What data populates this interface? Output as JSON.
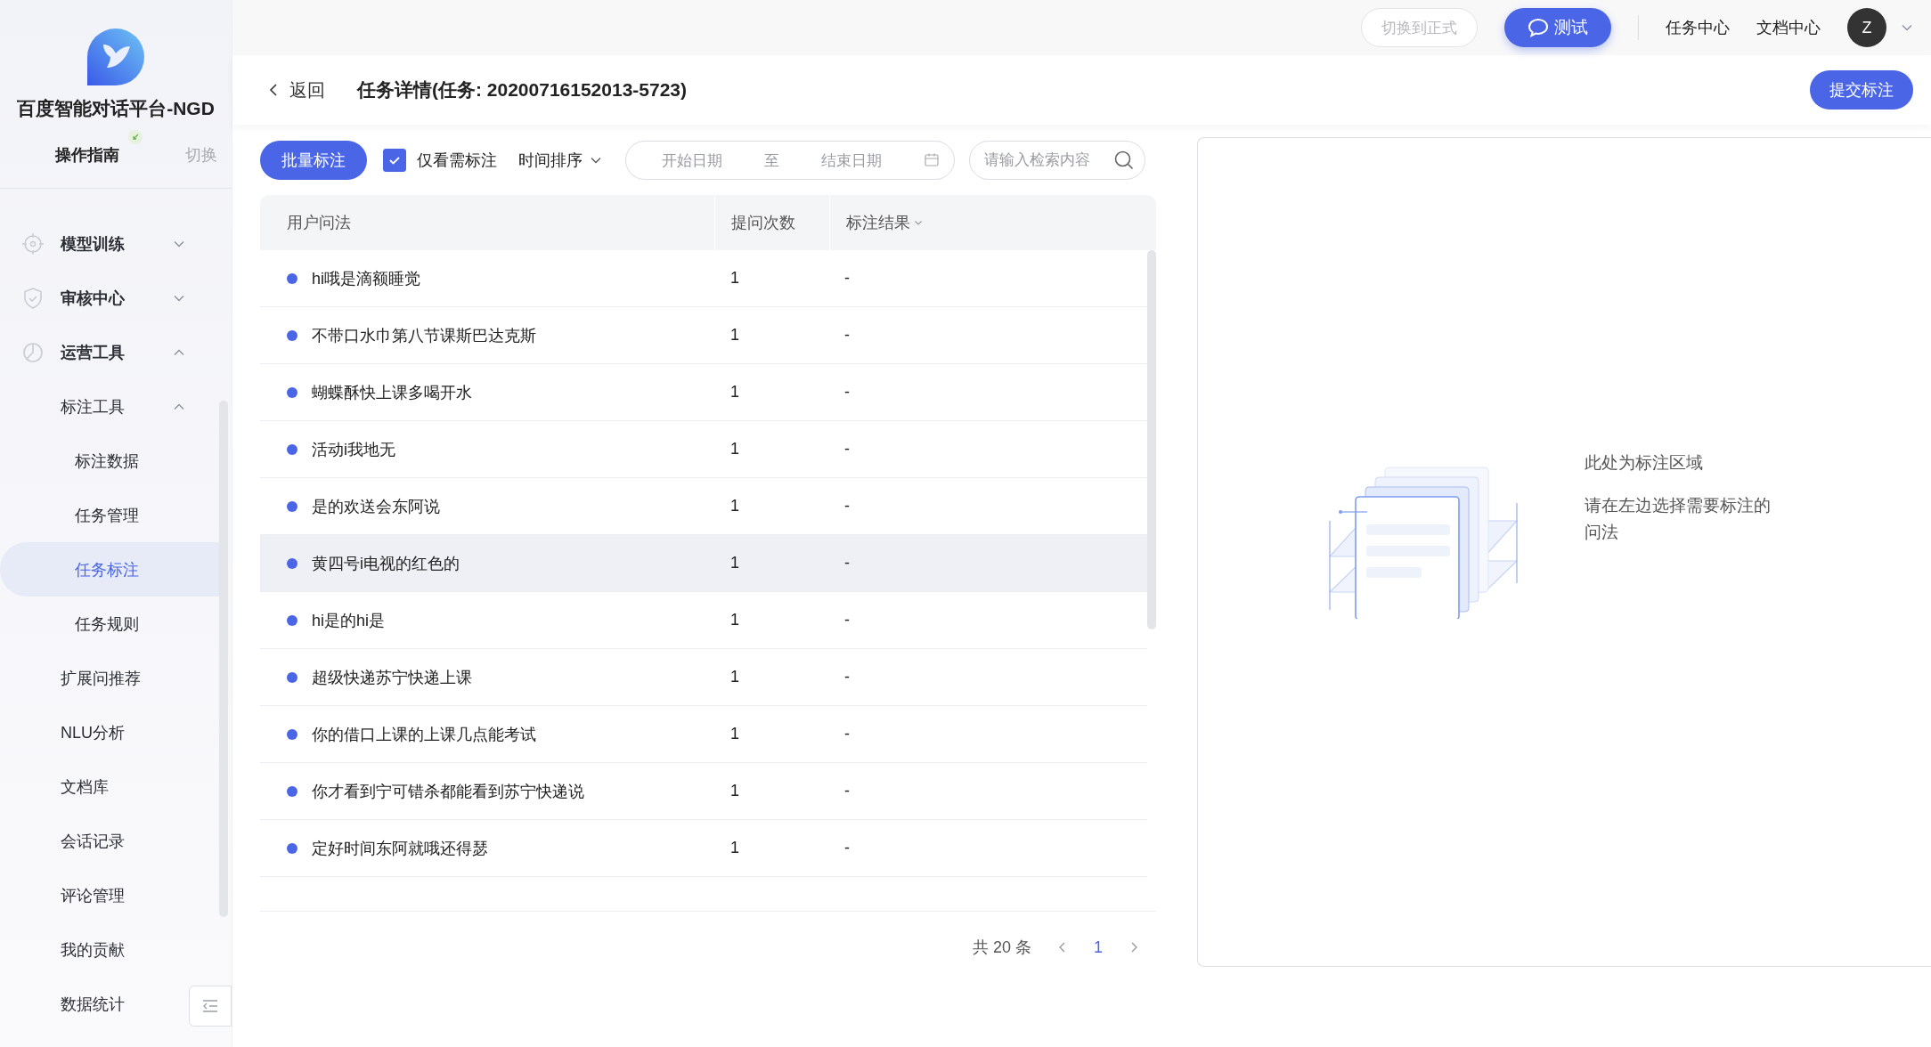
{
  "sidebar": {
    "brand": "百度智能对话平台-NGD",
    "guide": "操作指南",
    "switch": "切换",
    "items": [
      {
        "label": "模型训练",
        "selected": false,
        "expanded": false
      },
      {
        "label": "审核中心",
        "selected": false,
        "expanded": false
      },
      {
        "label": "运营工具",
        "selected": false,
        "expanded": true,
        "children": [
          {
            "label": "标注工具",
            "selected": false,
            "expanded": true,
            "children": [
              {
                "label": "标注数据",
                "selected": false
              },
              {
                "label": "任务管理",
                "selected": false
              },
              {
                "label": "任务标注",
                "selected": true
              },
              {
                "label": "任务规则",
                "selected": false
              }
            ]
          },
          {
            "label": "扩展问推荐",
            "selected": false
          },
          {
            "label": "NLU分析",
            "selected": false
          },
          {
            "label": "文档库",
            "selected": false
          },
          {
            "label": "会话记录",
            "selected": false
          },
          {
            "label": "评论管理",
            "selected": false
          },
          {
            "label": "我的贡献",
            "selected": false
          },
          {
            "label": "数据统计",
            "selected": false
          }
        ]
      }
    ]
  },
  "topbar": {
    "switch_button": {
      "label": "切换到正式",
      "disabled": true
    },
    "test_button": "测试",
    "links": [
      "任务中心",
      "文档中心"
    ],
    "avatar": "Z"
  },
  "header": {
    "back": "返回",
    "title": "任务详情(任务: 20200716152013-5723)",
    "submit": "提交标注"
  },
  "toolbar": {
    "batch": "批量标注",
    "only_needed": {
      "label": "仅看需标注",
      "checked": true
    },
    "sort": "时间排序",
    "date_start": {
      "placeholder": "开始日期"
    },
    "date_sep": "至",
    "date_end": {
      "placeholder": "结束日期"
    },
    "search": {
      "placeholder": "请输入检索内容"
    }
  },
  "table": {
    "columns": [
      {
        "label": "用户问法",
        "filter": false
      },
      {
        "label": "提问次数",
        "filter": false
      },
      {
        "label": "标注结果",
        "filter": true
      }
    ],
    "rows": [
      {
        "question": "hi哦是滴额睡觉",
        "count": "1",
        "result": "-",
        "highlighted": false
      },
      {
        "question": "不带口水巾第八节课斯巴达克斯",
        "count": "1",
        "result": "-",
        "highlighted": false
      },
      {
        "question": "蝴蝶酥快上课多喝开水",
        "count": "1",
        "result": "-",
        "highlighted": false
      },
      {
        "question": "活动i我地无",
        "count": "1",
        "result": "-",
        "highlighted": false
      },
      {
        "question": "是的欢送会东阿说",
        "count": "1",
        "result": "-",
        "highlighted": false
      },
      {
        "question": "黄四号i电视的红色的",
        "count": "1",
        "result": "-",
        "highlighted": true
      },
      {
        "question": "hi是的hi是",
        "count": "1",
        "result": "-",
        "highlighted": false
      },
      {
        "question": "超级快递苏宁快递上课",
        "count": "1",
        "result": "-",
        "highlighted": false
      },
      {
        "question": "你的借口上课的上课几点能考试",
        "count": "1",
        "result": "-",
        "highlighted": false
      },
      {
        "question": "你才看到宁可错杀都能看到苏宁快递说",
        "count": "1",
        "result": "-",
        "highlighted": false
      },
      {
        "question": "定好时间东阿就哦还得瑟",
        "count": "1",
        "result": "-",
        "highlighted": false
      }
    ]
  },
  "pagination": {
    "total": "共 20 条",
    "pages": [
      {
        "label": "1",
        "selected": true
      }
    ]
  },
  "annotation_panel": {
    "title": "此处为标注区域",
    "hint": "请在左边选择需要标注的问法"
  }
}
